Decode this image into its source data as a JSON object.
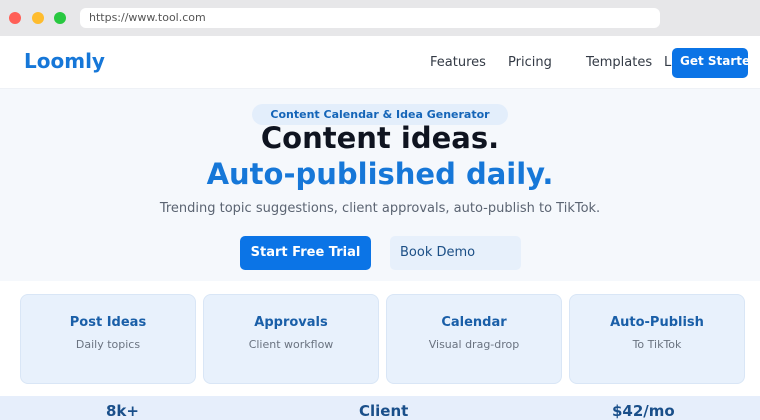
{
  "browser": {
    "url": "https://www.tool.com"
  },
  "nav": {
    "logo": "Loomly",
    "links": [
      "Features",
      "Pricing",
      "Templates",
      "L"
    ],
    "cta": "Get Started"
  },
  "hero": {
    "badge": "Content Calendar & Idea Generator",
    "title_line1": "Content ideas.",
    "title_line2": "Auto-published daily.",
    "subtitle": "Trending topic suggestions, client approvals, auto-publish to TikTok.",
    "primary_button": "Start Free Trial",
    "secondary_button": "Book Demo"
  },
  "features": [
    {
      "title": "Post Ideas",
      "desc": "Daily topics"
    },
    {
      "title": "Approvals",
      "desc": "Client workflow"
    },
    {
      "title": "Calendar",
      "desc": "Visual drag-drop"
    },
    {
      "title": "Auto-Publish",
      "desc": "To TikTok"
    }
  ],
  "stats": [
    "8k+",
    "Client",
    "$42/mo"
  ],
  "colors": {
    "brand": "#1677d8",
    "button": "#0b74e6",
    "card_bg": "#e8f1fc",
    "hero_bg": "#f5f8fc"
  }
}
